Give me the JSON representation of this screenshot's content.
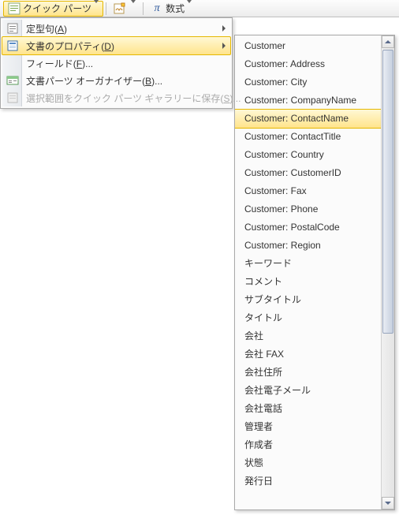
{
  "toolbar": {
    "quick_parts_label": "クイック パーツ",
    "equation_label": "数式"
  },
  "menu": {
    "items": [
      {
        "label": "定型句",
        "accel": "A",
        "icon": "autotext",
        "has_sub": true,
        "disabled": false,
        "highlight": false
      },
      {
        "label": "文書のプロパティ",
        "accel": "D",
        "icon": "doc-prop",
        "has_sub": true,
        "disabled": false,
        "highlight": true
      },
      {
        "label": "フィールド",
        "accel": "F",
        "suffix": "...",
        "icon": "field",
        "has_sub": false,
        "disabled": false,
        "highlight": false
      },
      {
        "label": "文書パーツ オーガナイザー",
        "accel": "B",
        "suffix": "...",
        "icon": "organizer",
        "has_sub": false,
        "disabled": false,
        "highlight": false
      },
      {
        "label": "選択範囲をクイック パーツ ギャラリーに保存",
        "accel": "S",
        "suffix": "...",
        "icon": "save-sel",
        "has_sub": false,
        "disabled": true,
        "highlight": false
      }
    ]
  },
  "submenu": {
    "items": [
      {
        "label": "Customer",
        "highlight": false
      },
      {
        "label": "Customer: Address",
        "highlight": false
      },
      {
        "label": "Customer: City",
        "highlight": false
      },
      {
        "label": "Customer: CompanyName",
        "highlight": false
      },
      {
        "label": "Customer: ContactName",
        "highlight": true
      },
      {
        "label": "Customer: ContactTitle",
        "highlight": false
      },
      {
        "label": "Customer: Country",
        "highlight": false
      },
      {
        "label": "Customer: CustomerID",
        "highlight": false
      },
      {
        "label": "Customer: Fax",
        "highlight": false
      },
      {
        "label": "Customer: Phone",
        "highlight": false
      },
      {
        "label": "Customer: PostalCode",
        "highlight": false
      },
      {
        "label": "Customer: Region",
        "highlight": false
      },
      {
        "label": "キーワード",
        "highlight": false
      },
      {
        "label": "コメント",
        "highlight": false
      },
      {
        "label": "サブタイトル",
        "highlight": false
      },
      {
        "label": "タイトル",
        "highlight": false
      },
      {
        "label": "会社",
        "highlight": false
      },
      {
        "label": "会社 FAX",
        "highlight": false
      },
      {
        "label": "会社住所",
        "highlight": false
      },
      {
        "label": "会社電子メール",
        "highlight": false
      },
      {
        "label": "会社電話",
        "highlight": false
      },
      {
        "label": "管理者",
        "highlight": false
      },
      {
        "label": "作成者",
        "highlight": false
      },
      {
        "label": "状態",
        "highlight": false
      },
      {
        "label": "発行日",
        "highlight": false
      }
    ]
  }
}
